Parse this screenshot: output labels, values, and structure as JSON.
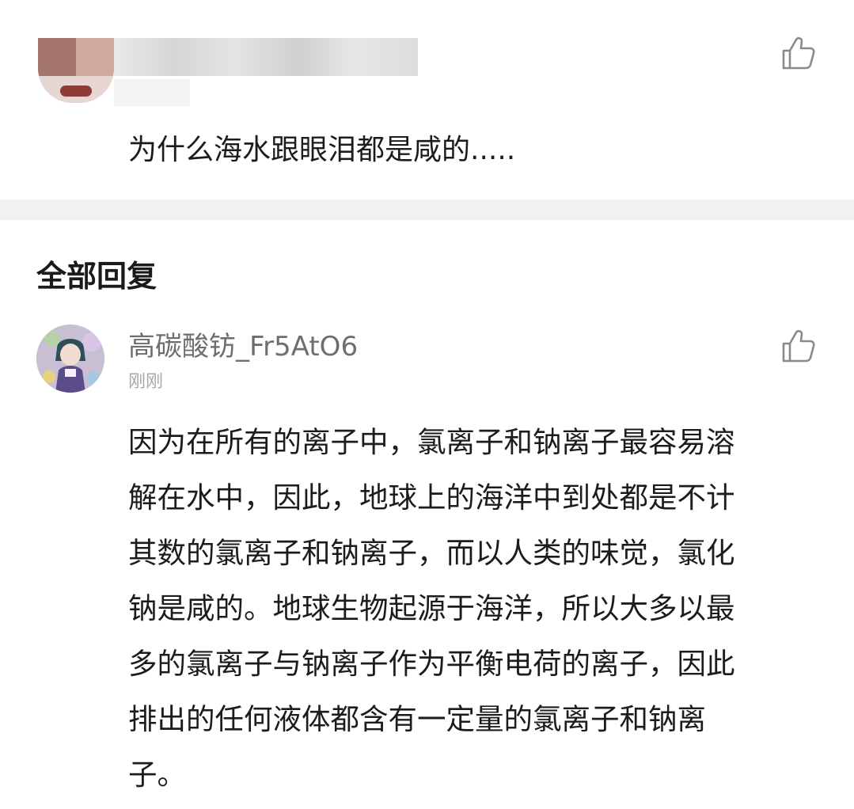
{
  "post": {
    "text": "为什么海水跟眼泪都是咸的....."
  },
  "replies": {
    "section_title": "全部回复",
    "items": [
      {
        "author": "高碳酸钫_Fr5AtO6",
        "time": "刚刚",
        "lines": [
          "因为在所有的离子中，氯离子和钠离子最容易溶",
          "解在水中，因此，地球上的海洋中到处都是不计",
          "其数的氯离子和钠离子，而以人类的味觉，氯化",
          "钠是咸的。地球生物起源于海洋，所以大多以最",
          "多的氯离子与钠离子作为平衡电荷的离子，因此",
          "排出的任何液体都含有一定量的氯离子和钠离",
          "子。"
        ]
      }
    ]
  },
  "icons": {
    "like": "thumbs-up-icon"
  },
  "colors": {
    "background": "#ffffff",
    "divider": "#f1f1f1",
    "author": "#6e6e6e",
    "timestamp": "#a8a8a8",
    "icon": "#8a8a8a"
  }
}
